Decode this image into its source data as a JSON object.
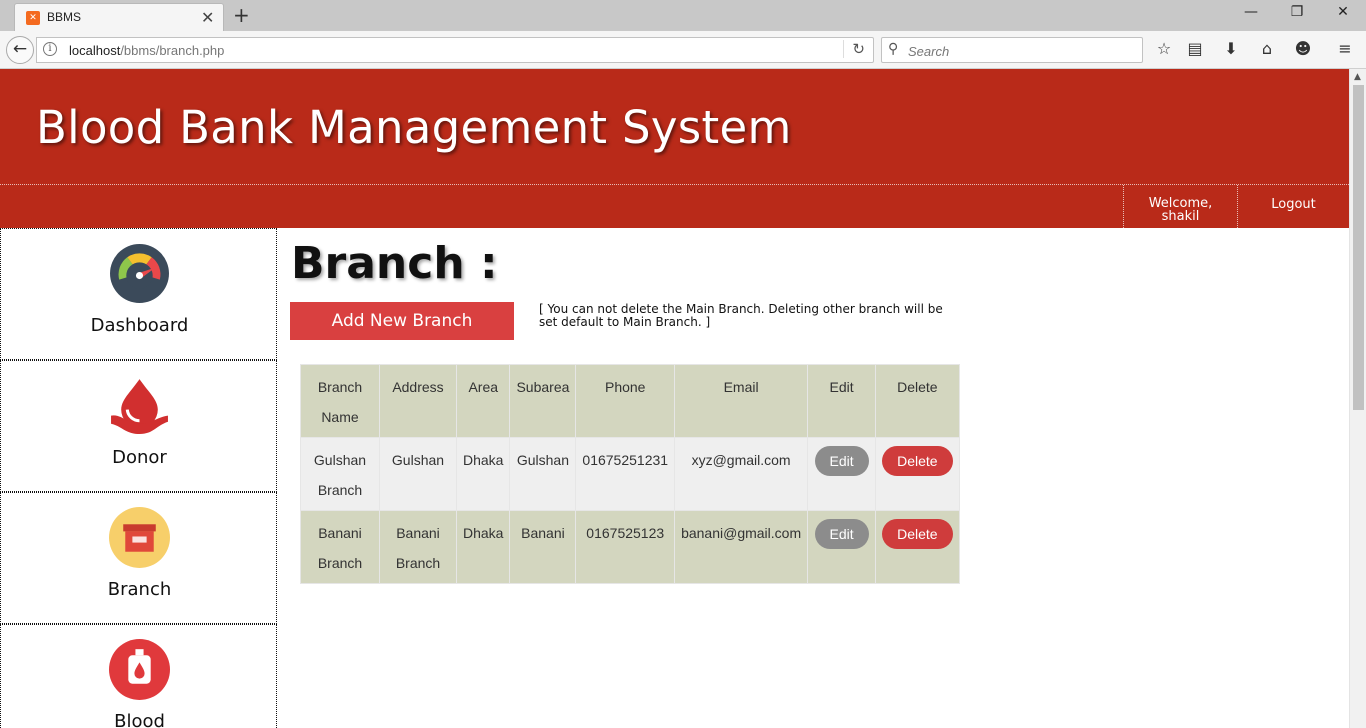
{
  "browser": {
    "tab_title": "BBMS",
    "url_host": "localhost",
    "url_path": "/bbms/branch.php",
    "search_placeholder": "Search"
  },
  "header": {
    "site_title": "Blood Bank Management System",
    "welcome": "Welcome,",
    "username": "shakil",
    "logout": "Logout"
  },
  "sidebar": {
    "items": [
      {
        "label": "Dashboard",
        "icon": "dashboard-gauge-icon"
      },
      {
        "label": "Donor",
        "icon": "blood-drop-hand-icon"
      },
      {
        "label": "Branch",
        "icon": "archive-box-icon"
      },
      {
        "label": "Blood",
        "icon": "blood-bag-icon"
      }
    ]
  },
  "main": {
    "title": "Branch :",
    "add_button": "Add New Branch",
    "note": "[ You can not delete the Main Branch. Deleting other branch will be set default to Main Branch. ]",
    "columns": [
      "Branch Name",
      "Address",
      "Area",
      "Subarea",
      "Phone",
      "Email",
      "Edit",
      "Delete"
    ],
    "rows": [
      {
        "branch": "Gulshan Branch",
        "address": "Gulshan",
        "area": "Dhaka",
        "subarea": "Gulshan",
        "phone": "01675251231",
        "email": "xyz@gmail.com",
        "edit": "Edit",
        "delete": "Delete"
      },
      {
        "branch": "Banani Branch",
        "address": "Banani Branch",
        "area": "Dhaka",
        "subarea": "Banani",
        "phone": "0167525123",
        "email": "banani@gmail.com",
        "edit": "Edit",
        "delete": "Delete"
      }
    ]
  },
  "colors": {
    "header_red": "#b92a19",
    "button_red": "#d94040",
    "table_green": "#d3d6bf",
    "edit_gray": "#8c8c8c"
  }
}
